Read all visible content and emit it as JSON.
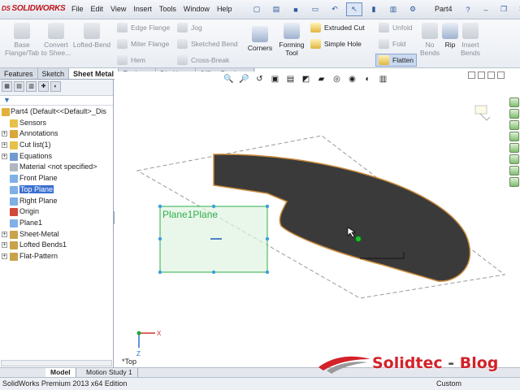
{
  "app": {
    "logo_text": "SOLIDWORKS",
    "doc_title": "Part4"
  },
  "menu": [
    "File",
    "Edit",
    "View",
    "Insert",
    "Tools",
    "Window",
    "Help"
  ],
  "quick_icons": [
    "new-file-icon",
    "open-file-icon",
    "save-icon",
    "print-icon",
    "undo-icon",
    "select-icon",
    "rebuild-icon",
    "file-properties-icon",
    "options-icon"
  ],
  "commands": {
    "base_flange": "Base Flange/Tab",
    "convert": "Convert to Shee...",
    "lofted_bend": "Lofted-Bend",
    "edge_flange": "Edge Flange",
    "miter_flange": "Miter Flange",
    "hem": "Hem",
    "jog": "Jog",
    "sketched_bend": "Sketched Bend",
    "cross_break": "Cross-Break",
    "corners": "Corners",
    "forming_tool": "Forming Tool",
    "extruded_cut": "Extruded Cut",
    "simple_hole": "Simple Hole",
    "unfold": "Unfold",
    "fold": "Fold",
    "flatten": "Flatten",
    "no_bends": "No Bends",
    "rip": "Rip",
    "insert_bends": "Insert Bends"
  },
  "tabs": [
    "Features",
    "Sketch",
    "Sheet Metal",
    "Evaluate",
    "DimXpert",
    "Office Products"
  ],
  "active_tab": "Sheet Metal",
  "tree": [
    {
      "label": "Part4  (Default<<Default>_Dis",
      "root": true,
      "color": "#e2b13b"
    },
    {
      "label": "Sensors",
      "exp": false,
      "color": "#e6c14a"
    },
    {
      "label": "Annotations",
      "exp": true,
      "color": "#d9a63a"
    },
    {
      "label": "Cut list(1)",
      "exp": true,
      "color": "#e6c14a"
    },
    {
      "label": "Equations",
      "exp": true,
      "color": "#6f9bd1"
    },
    {
      "label": "Material <not specified>",
      "exp": false,
      "color": "#b0b7c2"
    },
    {
      "label": "Front Plane",
      "exp": false,
      "color": "#7fb0e6"
    },
    {
      "label": "Top Plane",
      "exp": false,
      "color": "#7fb0e6",
      "selected": true
    },
    {
      "label": "Right Plane",
      "exp": false,
      "color": "#7fb0e6"
    },
    {
      "label": "Origin",
      "exp": false,
      "color": "#d14a3a"
    },
    {
      "label": "Plane1",
      "exp": false,
      "color": "#7fb0e6"
    },
    {
      "label": "Sheet-Metal",
      "exp": true,
      "color": "#c9a24a"
    },
    {
      "label": "Lofted Bends1",
      "exp": true,
      "color": "#c9a24a"
    },
    {
      "label": "Flat-Pattern",
      "exp": true,
      "color": "#c9a24a"
    }
  ],
  "viewport": {
    "plane_label": "Plane1Plane",
    "view_name": "*Top",
    "axis_x": "X",
    "axis_z": "Z"
  },
  "bottom_tabs": [
    "Model",
    "Motion Study 1"
  ],
  "status": {
    "edition": "SolidWorks Premium 2013 x64 Edition",
    "units": "Custom"
  },
  "watermark": {
    "brand": "Solidtec",
    "sep": " - ",
    "word": "Blog"
  },
  "colors": {
    "sheet": "#3a3a3a",
    "edge": "#c8893a",
    "plane": "#2fae4a",
    "selection": "#3a70d1"
  }
}
